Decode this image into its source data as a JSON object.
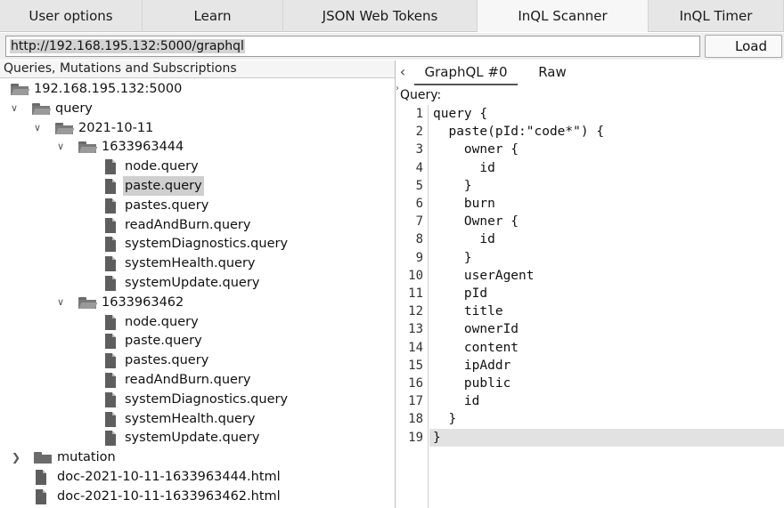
{
  "tabs": [
    {
      "label": "User options",
      "active": false
    },
    {
      "label": "Learn",
      "active": false
    },
    {
      "label": "JSON Web Tokens",
      "active": false
    },
    {
      "label": "InQL Scanner",
      "active": true
    },
    {
      "label": "InQL Timer",
      "active": false
    }
  ],
  "url": {
    "value": "http://192.168.195.132:5000/graphql"
  },
  "load_button": {
    "label": "Load"
  },
  "tree": {
    "header": "Queries, Mutations and Subscriptions",
    "nodes": [
      {
        "label": "192.168.195.132:5000",
        "icon": "folder-open-icon",
        "arrow": ""
      },
      {
        "label": "query",
        "icon": "folder-open-icon",
        "arrow": "chevron-down-icon"
      },
      {
        "label": "2021-10-11",
        "icon": "folder-open-icon",
        "arrow": "chevron-down-icon"
      },
      {
        "label": "1633963444",
        "icon": "folder-open-icon",
        "arrow": "chevron-down-icon"
      },
      {
        "label": "node.query",
        "icon": "file-icon"
      },
      {
        "label": "paste.query",
        "icon": "file-icon",
        "selected": true
      },
      {
        "label": "pastes.query",
        "icon": "file-icon"
      },
      {
        "label": "readAndBurn.query",
        "icon": "file-icon"
      },
      {
        "label": "systemDiagnostics.query",
        "icon": "file-icon"
      },
      {
        "label": "systemHealth.query",
        "icon": "file-icon"
      },
      {
        "label": "systemUpdate.query",
        "icon": "file-icon"
      },
      {
        "label": "1633963462",
        "icon": "folder-open-icon",
        "arrow": "chevron-down-icon"
      },
      {
        "label": "node.query",
        "icon": "file-icon"
      },
      {
        "label": "paste.query",
        "icon": "file-icon"
      },
      {
        "label": "pastes.query",
        "icon": "file-icon"
      },
      {
        "label": "readAndBurn.query",
        "icon": "file-icon"
      },
      {
        "label": "systemDiagnostics.query",
        "icon": "file-icon"
      },
      {
        "label": "systemHealth.query",
        "icon": "file-icon"
      },
      {
        "label": "systemUpdate.query",
        "icon": "file-icon"
      },
      {
        "label": "mutation",
        "icon": "folder-closed-icon",
        "arrow": "chevron-right-icon"
      },
      {
        "label": "doc-2021-10-11-1633963444.html",
        "icon": "file-icon"
      },
      {
        "label": "doc-2021-10-11-1633963462.html",
        "icon": "file-icon"
      }
    ]
  },
  "editor": {
    "tabs": [
      {
        "label": "GraphQL #0",
        "active": true
      },
      {
        "label": "Raw",
        "active": false
      }
    ],
    "query_label": "Query:",
    "current_line": 19,
    "lines": [
      "query {",
      "  paste(pId:\"code*\") {",
      "    owner {",
      "      id",
      "    }",
      "    burn",
      "    Owner {",
      "      id",
      "    }",
      "    userAgent",
      "    pId",
      "    title",
      "    ownerId",
      "    content",
      "    ipAddr",
      "    public",
      "    id",
      "  }",
      "}"
    ],
    "line_numbers": [
      "1",
      "2",
      "3",
      "4",
      "5",
      "6",
      "7",
      "8",
      "9",
      "10",
      "11",
      "12",
      "13",
      "14",
      "15",
      "16",
      "17",
      "18",
      "19"
    ]
  }
}
